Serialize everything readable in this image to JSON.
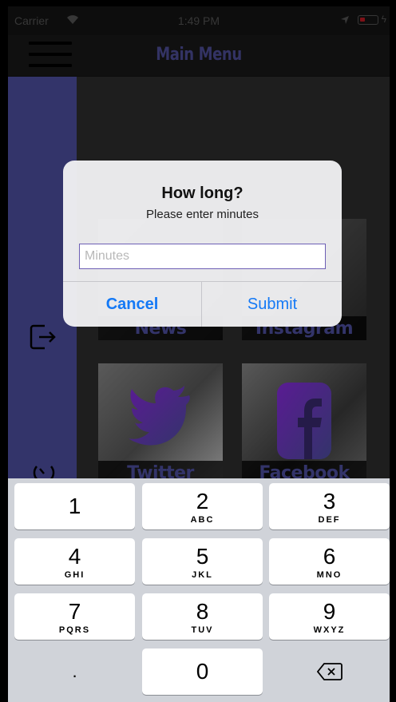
{
  "status_bar": {
    "carrier": "Carrier",
    "time": "1:49 PM"
  },
  "nav": {
    "title": "Main Menu"
  },
  "tiles": [
    {
      "label": "News"
    },
    {
      "label": "Instagram"
    },
    {
      "label": "Twitter"
    },
    {
      "label": "Facebook"
    }
  ],
  "alert": {
    "title": "How long?",
    "message": "Please enter minutes",
    "input_placeholder": "Minutes",
    "input_value": "",
    "cancel_label": "Cancel",
    "submit_label": "Submit"
  },
  "keypad": {
    "keys": [
      {
        "digit": "1",
        "letters": ""
      },
      {
        "digit": "2",
        "letters": "ABC"
      },
      {
        "digit": "3",
        "letters": "DEF"
      },
      {
        "digit": "4",
        "letters": "GHI"
      },
      {
        "digit": "5",
        "letters": "JKL"
      },
      {
        "digit": "6",
        "letters": "MNO"
      },
      {
        "digit": "7",
        "letters": "PQRS"
      },
      {
        "digit": "8",
        "letters": "TUV"
      },
      {
        "digit": "9",
        "letters": "WXYZ"
      },
      {
        "digit": "."
      },
      {
        "digit": "0"
      }
    ]
  },
  "colors": {
    "accent": "#4f50a4",
    "link": "#1479f6"
  },
  "icons": [
    "menu-icon",
    "logout-icon",
    "timer-icon",
    "wifi-icon",
    "location-icon",
    "battery-icon",
    "delete-icon",
    "twitter-logo-icon",
    "facebook-logo-icon"
  ]
}
